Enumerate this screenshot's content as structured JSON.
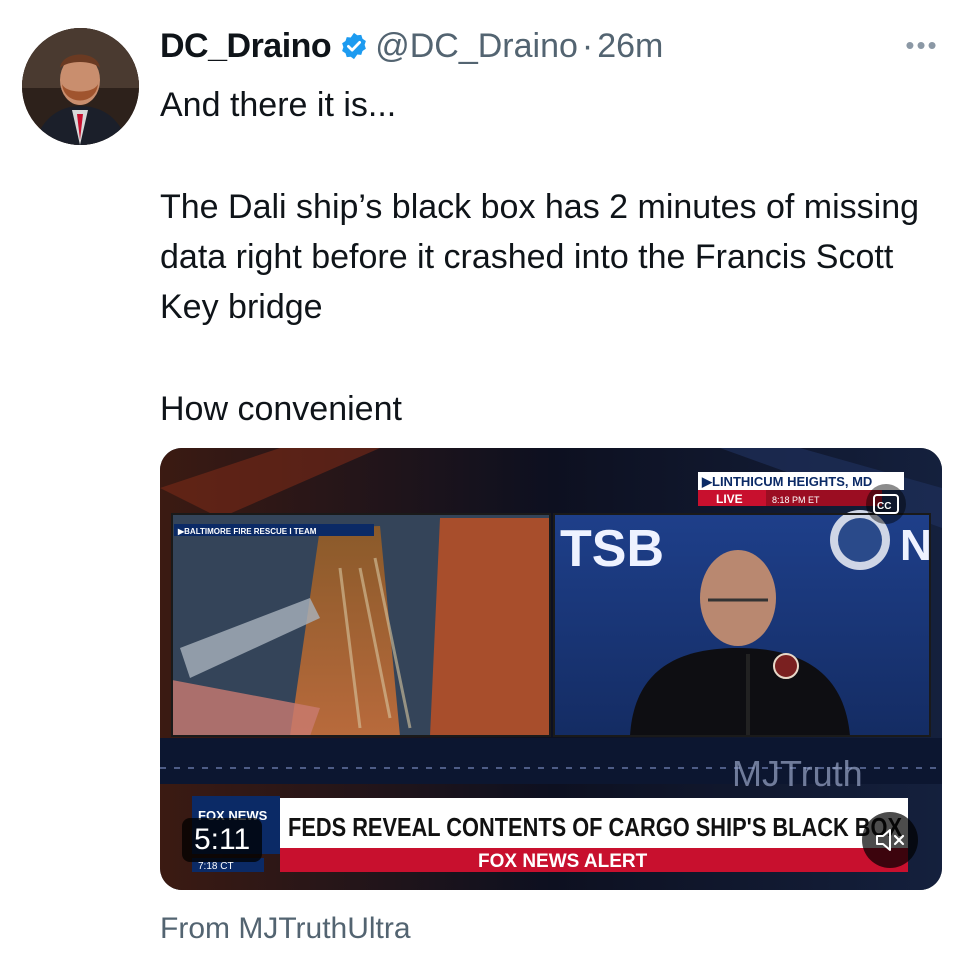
{
  "tweet": {
    "author_name": "DC_Draino",
    "author_handle": "@DC_Draino",
    "separator": "·",
    "time": "26m",
    "more_label": "•••",
    "lines": [
      "And there it is...",
      "The Dali ship’s black box has 2 minutes of missing data right before it crashed into the Francis Scott Key bridge",
      "How convenient"
    ],
    "source": "From MJTruthUltra"
  },
  "video": {
    "duration": "5:11",
    "location": "▶LINTHICUM HEIGHTS, MD",
    "live": "LIVE",
    "live_time": "8:18 PM ET",
    "inset_label": "▶BALTIMORE FIRE RESCUE I TEAM",
    "backdrop_text": "TSB",
    "backdrop_text_right": "N",
    "watermark": "MJTruth",
    "headline": "FEDS REVEAL CONTENTS OF CARGO SHIP'S BLACK BOX",
    "alert": "FOX NEWS ALERT",
    "network_logo": "FOX NEWS",
    "clock": "7:18 CT",
    "cc_label": "CC"
  },
  "colors": {
    "verified": "#1d9bf0",
    "secondary_text": "#536471",
    "fox_red": "#c8102e",
    "fox_blue": "#0b2a66"
  },
  "icons": [
    "verified-badge-icon",
    "more-icon",
    "mute-icon",
    "closed-captions-icon"
  ]
}
